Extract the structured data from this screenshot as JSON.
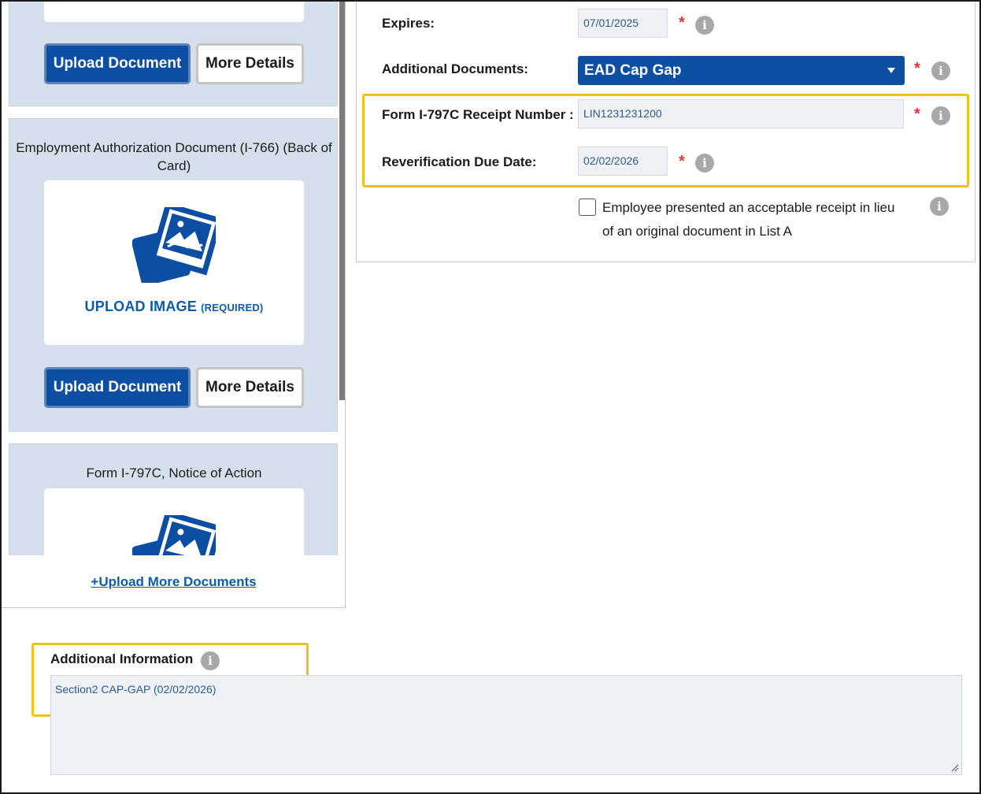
{
  "documents": {
    "cards": [
      {
        "title": "",
        "upload_button": "Upload Document",
        "more_button": "More Details"
      },
      {
        "title": "Employment Authorization Document (I-766) (Back of Card)",
        "upload_label": "UPLOAD IMAGE",
        "upload_required": "(REQUIRED)",
        "upload_button": "Upload Document",
        "more_button": "More Details"
      },
      {
        "title": "Form I-797C, Notice of Action"
      }
    ],
    "upload_more_link": "+Upload More Documents"
  },
  "form": {
    "expires_label": "Expires:",
    "expires_value": "07/01/2025",
    "additional_docs_label": "Additional Documents:",
    "additional_docs_value": "EAD Cap Gap",
    "receipt_label": "Form I-797C Receipt Number :",
    "receipt_value": "LIN1231231200",
    "reverification_label": "Reverification Due Date:",
    "reverification_value": "02/02/2026",
    "receipt_checkbox_label": "Employee presented an acceptable receipt in lieu of an original document in List A",
    "required_mark": "*",
    "info_glyph": "i"
  },
  "additional_info": {
    "title": "Additional Information",
    "value": "Section2 CAP-GAP (02/02/2026)"
  },
  "colors": {
    "primary": "#0b4ea2",
    "card_bg": "#d6e0ec",
    "highlight": "#f1c21b",
    "required": "#d83933"
  },
  "icons": [
    "photo-upload-icon",
    "info-icon",
    "dropdown-arrow-icon",
    "resize-handle-icon"
  ]
}
